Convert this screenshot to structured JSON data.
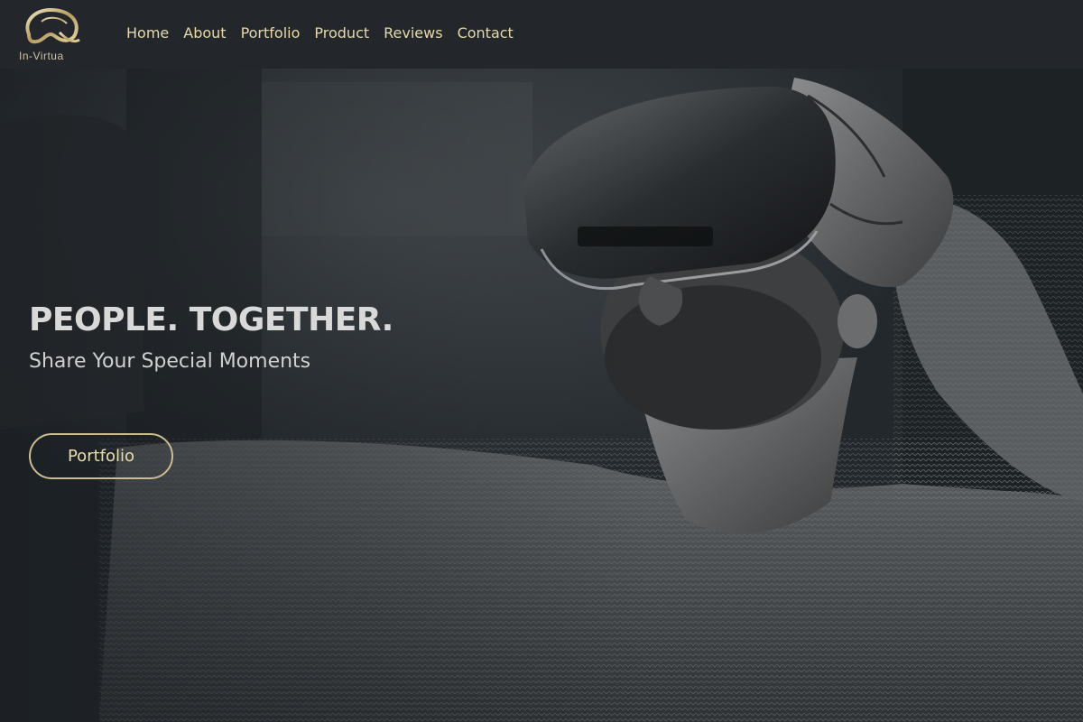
{
  "brand": {
    "name": "In-Virtua",
    "logo_icon": "vr-headset-logo-icon"
  },
  "nav": {
    "items": [
      {
        "label": "Home"
      },
      {
        "label": "About"
      },
      {
        "label": "Portfolio"
      },
      {
        "label": "Product"
      },
      {
        "label": "Reviews"
      },
      {
        "label": "Contact"
      }
    ]
  },
  "hero": {
    "headline": "PEOPLE. TOGETHER.",
    "subheadline": "Share Your Special Moments",
    "cta_label": "Portfolio",
    "image": "man-wearing-vr-headset-photo"
  },
  "colors": {
    "header_bg": "#23272b",
    "hero_bg": "#1e2327",
    "accent_gold": "#cbbd8f",
    "nav_text": "#e6d8a8",
    "headline_text": "#d9d9d9"
  }
}
